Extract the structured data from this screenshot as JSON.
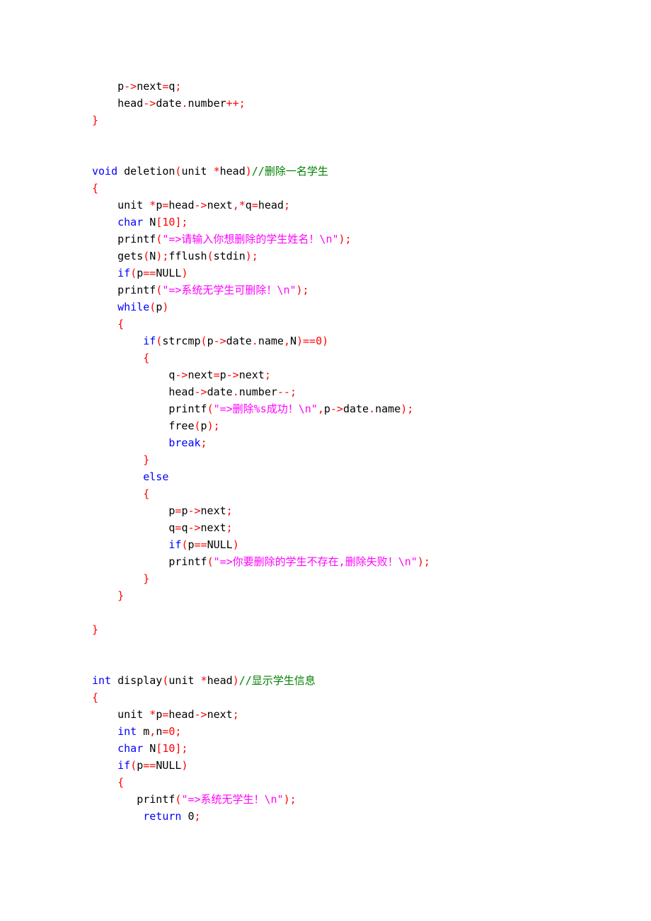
{
  "code": {
    "lines": [
      [
        [
          "    p",
          ""
        ],
        [
          "->",
          "op"
        ],
        [
          "next",
          ""
        ],
        [
          "=",
          "op"
        ],
        [
          "q",
          ""
        ],
        [
          ";",
          "op"
        ]
      ],
      [
        [
          "    head",
          ""
        ],
        [
          "->",
          "op"
        ],
        [
          "date",
          ""
        ],
        [
          ".",
          "op"
        ],
        [
          "number",
          ""
        ],
        [
          "++;",
          "op"
        ]
      ],
      [
        [
          "}",
          "op"
        ]
      ],
      [
        [
          "",
          ""
        ]
      ],
      [
        [
          "",
          ""
        ]
      ],
      [
        [
          "void ",
          "kw"
        ],
        [
          "deletion",
          ""
        ],
        [
          "(",
          "op"
        ],
        [
          "unit ",
          ""
        ],
        [
          "*",
          "op"
        ],
        [
          "head",
          ""
        ],
        [
          ")",
          "op"
        ],
        [
          "//删除一名学生",
          "cmt"
        ]
      ],
      [
        [
          "{",
          "op"
        ]
      ],
      [
        [
          "    unit ",
          ""
        ],
        [
          "*",
          "op"
        ],
        [
          "p",
          ""
        ],
        [
          "=",
          "op"
        ],
        [
          "head",
          ""
        ],
        [
          "->",
          "op"
        ],
        [
          "next",
          ""
        ],
        [
          ",",
          "op"
        ],
        [
          "*",
          "op"
        ],
        [
          "q",
          ""
        ],
        [
          "=",
          "op"
        ],
        [
          "head",
          ""
        ],
        [
          ";",
          "op"
        ]
      ],
      [
        [
          "    ",
          "kw"
        ],
        [
          "char ",
          "kw"
        ],
        [
          "N",
          ""
        ],
        [
          "[",
          "op"
        ],
        [
          "10",
          "num"
        ],
        [
          "];",
          "op"
        ]
      ],
      [
        [
          "    printf",
          ""
        ],
        [
          "(",
          "op"
        ],
        [
          "\"=>请输入你想删除的学生姓名！\\n\"",
          "str"
        ],
        [
          ");",
          "op"
        ]
      ],
      [
        [
          "    gets",
          ""
        ],
        [
          "(",
          "op"
        ],
        [
          "N",
          ""
        ],
        [
          ");",
          "op"
        ],
        [
          "fflush",
          ""
        ],
        [
          "(",
          "op"
        ],
        [
          "stdin",
          ""
        ],
        [
          ");",
          "op"
        ]
      ],
      [
        [
          "    ",
          "kw"
        ],
        [
          "if",
          "kw"
        ],
        [
          "(",
          "op"
        ],
        [
          "p",
          ""
        ],
        [
          "==",
          "op"
        ],
        [
          "NULL",
          ""
        ],
        [
          ")",
          "op"
        ]
      ],
      [
        [
          "    printf",
          ""
        ],
        [
          "(",
          "op"
        ],
        [
          "\"=>系统无学生可删除！\\n\"",
          "str"
        ],
        [
          ");",
          "op"
        ]
      ],
      [
        [
          "    ",
          "kw"
        ],
        [
          "while",
          "kw"
        ],
        [
          "(",
          "op"
        ],
        [
          "p",
          ""
        ],
        [
          ")",
          "op"
        ]
      ],
      [
        [
          "    ",
          ""
        ],
        [
          "{",
          "op"
        ]
      ],
      [
        [
          "        ",
          "kw"
        ],
        [
          "if",
          "kw"
        ],
        [
          "(",
          "op"
        ],
        [
          "strcmp",
          ""
        ],
        [
          "(",
          "op"
        ],
        [
          "p",
          ""
        ],
        [
          "->",
          "op"
        ],
        [
          "date",
          ""
        ],
        [
          ".",
          "op"
        ],
        [
          "name",
          ""
        ],
        [
          ",",
          "op"
        ],
        [
          "N",
          ""
        ],
        [
          ")==",
          "op"
        ],
        [
          "0",
          "num"
        ],
        [
          ")",
          "op"
        ]
      ],
      [
        [
          "        ",
          ""
        ],
        [
          "{",
          "op"
        ]
      ],
      [
        [
          "            q",
          ""
        ],
        [
          "->",
          "op"
        ],
        [
          "next",
          ""
        ],
        [
          "=",
          "op"
        ],
        [
          "p",
          ""
        ],
        [
          "->",
          "op"
        ],
        [
          "next",
          ""
        ],
        [
          ";",
          "op"
        ]
      ],
      [
        [
          "            head",
          ""
        ],
        [
          "->",
          "op"
        ],
        [
          "date",
          ""
        ],
        [
          ".",
          "op"
        ],
        [
          "number",
          ""
        ],
        [
          "--;",
          "op"
        ]
      ],
      [
        [
          "            printf",
          ""
        ],
        [
          "(",
          "op"
        ],
        [
          "\"=>删除%s成功！\\n\"",
          "str"
        ],
        [
          ",",
          "op"
        ],
        [
          "p",
          ""
        ],
        [
          "->",
          "op"
        ],
        [
          "date",
          ""
        ],
        [
          ".",
          "op"
        ],
        [
          "name",
          ""
        ],
        [
          ");",
          "op"
        ]
      ],
      [
        [
          "            free",
          ""
        ],
        [
          "(",
          "op"
        ],
        [
          "p",
          ""
        ],
        [
          ");",
          "op"
        ]
      ],
      [
        [
          "            ",
          "kw"
        ],
        [
          "break",
          "kw"
        ],
        [
          ";",
          "op"
        ]
      ],
      [
        [
          "        ",
          ""
        ],
        [
          "}",
          "op"
        ]
      ],
      [
        [
          "        ",
          "kw"
        ],
        [
          "else",
          "kw"
        ]
      ],
      [
        [
          "        ",
          ""
        ],
        [
          "{",
          "op"
        ]
      ],
      [
        [
          "            p",
          ""
        ],
        [
          "=",
          "op"
        ],
        [
          "p",
          ""
        ],
        [
          "->",
          "op"
        ],
        [
          "next",
          ""
        ],
        [
          ";",
          "op"
        ]
      ],
      [
        [
          "            q",
          ""
        ],
        [
          "=",
          "op"
        ],
        [
          "q",
          ""
        ],
        [
          "->",
          "op"
        ],
        [
          "next",
          ""
        ],
        [
          ";",
          "op"
        ]
      ],
      [
        [
          "            ",
          "kw"
        ],
        [
          "if",
          "kw"
        ],
        [
          "(",
          "op"
        ],
        [
          "p",
          ""
        ],
        [
          "==",
          "op"
        ],
        [
          "NULL",
          ""
        ],
        [
          ")",
          "op"
        ]
      ],
      [
        [
          "            printf",
          ""
        ],
        [
          "(",
          "op"
        ],
        [
          "\"=>你要删除的学生不存在,删除失败！\\n\"",
          "str"
        ],
        [
          ");",
          "op"
        ]
      ],
      [
        [
          "        ",
          ""
        ],
        [
          "}",
          "op"
        ]
      ],
      [
        [
          "    ",
          ""
        ],
        [
          "}",
          "op"
        ]
      ],
      [
        [
          "",
          ""
        ]
      ],
      [
        [
          "}",
          "op"
        ]
      ],
      [
        [
          "",
          ""
        ]
      ],
      [
        [
          "",
          ""
        ]
      ],
      [
        [
          "int ",
          "kw"
        ],
        [
          "display",
          ""
        ],
        [
          "(",
          "op"
        ],
        [
          "unit ",
          ""
        ],
        [
          "*",
          "op"
        ],
        [
          "head",
          ""
        ],
        [
          ")",
          "op"
        ],
        [
          "//显示学生信息",
          "cmt"
        ]
      ],
      [
        [
          "{",
          "op"
        ]
      ],
      [
        [
          "    unit ",
          ""
        ],
        [
          "*",
          "op"
        ],
        [
          "p",
          ""
        ],
        [
          "=",
          "op"
        ],
        [
          "head",
          ""
        ],
        [
          "->",
          "op"
        ],
        [
          "next",
          ""
        ],
        [
          ";",
          "op"
        ]
      ],
      [
        [
          "    ",
          "kw"
        ],
        [
          "int ",
          "kw"
        ],
        [
          "m",
          ""
        ],
        [
          ",",
          "op"
        ],
        [
          "n",
          ""
        ],
        [
          "=",
          "op"
        ],
        [
          "0",
          "num"
        ],
        [
          ";",
          "op"
        ]
      ],
      [
        [
          "    ",
          "kw"
        ],
        [
          "char ",
          "kw"
        ],
        [
          "N",
          ""
        ],
        [
          "[",
          "op"
        ],
        [
          "10",
          "num"
        ],
        [
          "];",
          "op"
        ]
      ],
      [
        [
          "    ",
          "kw"
        ],
        [
          "if",
          "kw"
        ],
        [
          "(",
          "op"
        ],
        [
          "p",
          ""
        ],
        [
          "==",
          "op"
        ],
        [
          "NULL",
          ""
        ],
        [
          ")",
          "op"
        ]
      ],
      [
        [
          "    ",
          ""
        ],
        [
          "{",
          "op"
        ]
      ],
      [
        [
          "       printf",
          ""
        ],
        [
          "(",
          "op"
        ],
        [
          "\"=>系统无学生！\\n\"",
          "str"
        ],
        [
          ");",
          "op"
        ]
      ],
      [
        [
          "        ",
          "kw"
        ],
        [
          "return ",
          "kw"
        ],
        [
          "0",
          ""
        ],
        [
          ";",
          "op"
        ]
      ]
    ]
  }
}
